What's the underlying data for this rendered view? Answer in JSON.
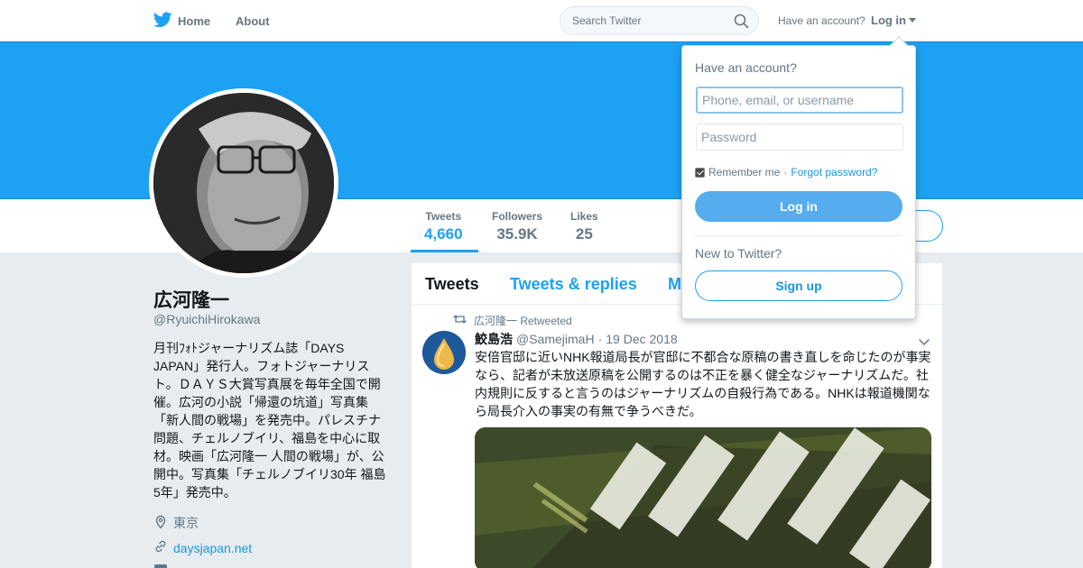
{
  "nav": {
    "home_label": "Home",
    "about_label": "About",
    "search_placeholder": "Search Twitter",
    "have_account": "Have an account?",
    "login_label": "Log in"
  },
  "profile": {
    "name": "広河隆一",
    "handle": "@RyuichiHirokawa",
    "bio": "月刊ﾌｫﾄジャーナリズム誌「DAYS JAPAN」発行人。フォトジャーナリスト。ＤＡＹＳ大賞写真展を毎年全国で開催。広河の小説「帰還の坑道」写真集「新人間の戦場」を発売中。パレスチナ問題、チェルノブイリ、福島を中心に取材。映画「広河隆一 人間の戦場」が、公開中。写真集「チェルノブイリ30年 福島5年」発売中。",
    "location": "東京",
    "url": "daysjapan.net"
  },
  "stats": [
    {
      "label": "Tweets",
      "value": "4,660"
    },
    {
      "label": "Followers",
      "value": "35.9K"
    },
    {
      "label": "Likes",
      "value": "25"
    }
  ],
  "timeline": {
    "tabs": [
      "Tweets",
      "Tweets & replies",
      "M"
    ],
    "tweet": {
      "retweet_label": "広河隆一 Retweeted",
      "author_name": "鮫島浩",
      "author_handle": "@SamejimaH",
      "separator": "·",
      "date": "19 Dec 2018",
      "text": "安倍官邸に近いNHK報道局長が官邸に不都合な原稿の書き直しを命じたのが事実なら、記者が未放送原稿を公開するのは不正を暴く健全なジャーナリズムだ。社内規則に反すると言うのはジャーナリズムの自殺行為である。NHKは報道機関なら局長介入の事実の有無で争うべきだ。"
    }
  },
  "login_dropdown": {
    "title": "Have an account?",
    "username_placeholder": "Phone, email, or username",
    "password_placeholder": "Password",
    "remember_label": "Remember me",
    "separator": "·",
    "forgot_label": "Forgot password?",
    "login_button": "Log in",
    "new_label": "New to Twitter?",
    "signup_button": "Sign up"
  },
  "colors": {
    "brand": "#1da1f2",
    "banner": "#1da1f2",
    "background": "#e6ecf0"
  },
  "icons": [
    "twitter-bird-icon",
    "search-icon",
    "caret-down-icon",
    "location-pin-icon",
    "link-icon",
    "retweet-icon",
    "chevron-down-icon"
  ]
}
